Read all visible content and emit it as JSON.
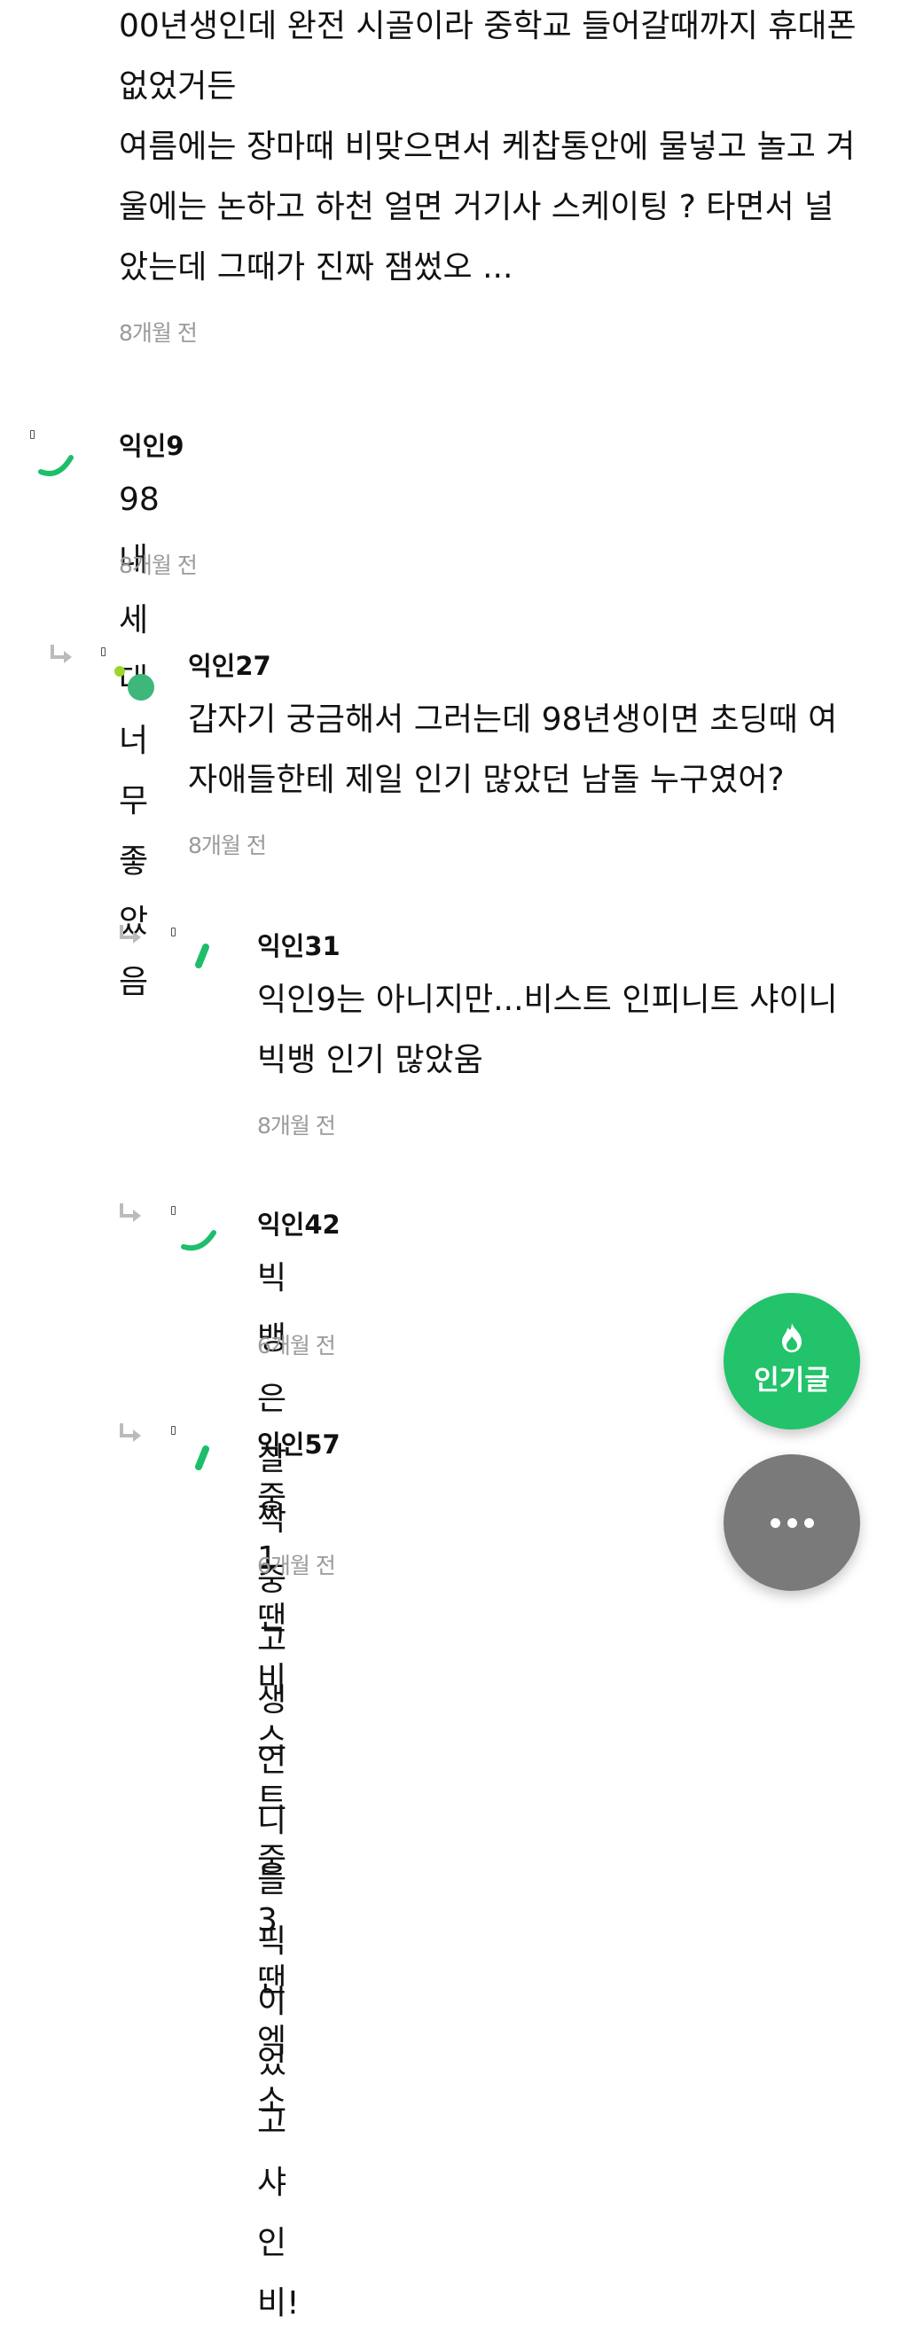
{
  "comments": [
    {
      "text": "00년생인데 완전 시골이라 중학교 들어갈때까지 휴대폰\n없었거든\n여름에는 장마때 비맞으면서 케찹통안에 물넣고 놀고 겨\n울에는 논하고 하천 얼면 거기사 스케이팅 ? 타면서 널\n았는데 그때가 진짜 잼썼오 ...",
      "time": "8개월 전"
    },
    {
      "author": "익인9",
      "text": "98 내 세대 너무 좋았음",
      "time": "8개월 전"
    },
    {
      "author": "익인27",
      "text": "갑자기 궁금해서 그러는데 98년생이면 초딩때 여\n자애들한테 제일 인기 많았던 남돌 누구였어?",
      "time": "8개월 전"
    },
    {
      "author": "익인31",
      "text": "익인9는 아니지만...비스트 인피니트 샤이니\n빅뱅 인기 많았움",
      "time": "8개월 전"
    },
    {
      "author": "익인42",
      "text": "빅뱅은 살짝 중고생언니들 픽이었고 샤인비!",
      "time": "6개월 전"
    },
    {
      "author": "익인57",
      "text": "중1땐 비스트 중3땐 엑소",
      "time": "6개월 전"
    }
  ],
  "fab": {
    "popular_label": "인기글",
    "popular_icon": "flame-icon",
    "more_icon": "more-dots-icon"
  },
  "colors": {
    "accent_green": "#22c36a",
    "fab_gray": "#7a7a7a",
    "meta_gray": "#9a9a9a",
    "divider": "#ebebeb"
  }
}
